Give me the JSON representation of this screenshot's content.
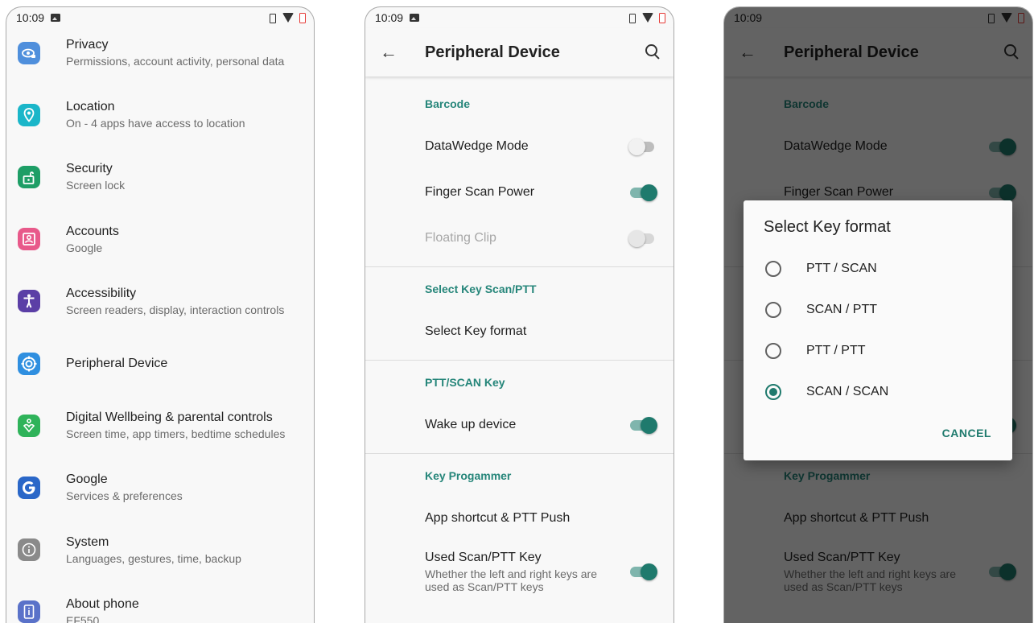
{
  "status": {
    "time": "10:09"
  },
  "settings": {
    "items": [
      {
        "title": "Privacy",
        "subtitle": "Permissions, account activity, personal data",
        "icon": "eye-lock-icon",
        "color": "#4f8fdc"
      },
      {
        "title": "Location",
        "subtitle": "On - 4 apps have access to location",
        "icon": "location-pin-icon",
        "color": "#1ab6c9"
      },
      {
        "title": "Security",
        "subtitle": "Screen lock",
        "icon": "lock-open-icon",
        "color": "#1e9e66"
      },
      {
        "title": "Accounts",
        "subtitle": "Google",
        "icon": "account-box-icon",
        "color": "#e8598a"
      },
      {
        "title": "Accessibility",
        "subtitle": "Screen readers, display, interaction controls",
        "icon": "accessibility-icon",
        "color": "#5b3fa6"
      },
      {
        "title": "Peripheral Device",
        "subtitle": "",
        "icon": "peripheral-device-icon",
        "color": "#2f8fe0"
      },
      {
        "title": "Digital Wellbeing & parental controls",
        "subtitle": "Screen time, app timers, bedtime schedules",
        "icon": "wellbeing-icon",
        "color": "#2fb35a"
      },
      {
        "title": "Google",
        "subtitle": "Services & preferences",
        "icon": "google-g-icon",
        "color": "#2a67c8"
      },
      {
        "title": "System",
        "subtitle": "Languages, gestures, time, backup",
        "icon": "info-icon",
        "color": "#8a8a8a"
      },
      {
        "title": "About phone",
        "subtitle": "EF550",
        "icon": "phone-info-icon",
        "color": "#5a72c9"
      }
    ]
  },
  "peripheral": {
    "title": "Peripheral Device",
    "cat_barcode": "Barcode",
    "datawedge": "DataWedge Mode",
    "finger_scan": "Finger Scan Power",
    "floating_clip": "Floating Clip",
    "cat_select_key": "Select Key Scan/PTT",
    "select_key_format": "Select Key format",
    "cat_ptt_scan": "PTT/SCAN Key",
    "wake_up": "Wake up device",
    "cat_key_prog": "Key Progammer",
    "app_shortcut": "App shortcut & PTT Push",
    "used_key": "Used Scan/PTT Key",
    "used_key_sub": "Whether the left and right keys are used as Scan/PTT keys"
  },
  "dialog": {
    "title": "Select Key format",
    "options": [
      "PTT / SCAN",
      "SCAN / PTT",
      "PTT / PTT",
      "SCAN / SCAN"
    ],
    "selected_index": 3,
    "cancel": "CANCEL"
  },
  "colors": {
    "accent": "#1f7a6d",
    "category": "#26867a"
  }
}
